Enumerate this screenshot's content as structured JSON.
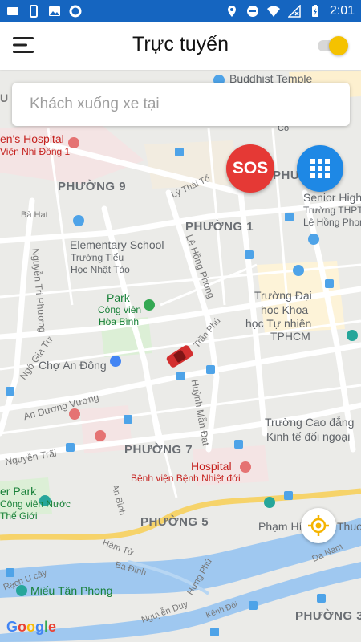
{
  "status_bar": {
    "time": "2:01"
  },
  "header": {
    "title": "Trực tuyến",
    "online_toggle": "on"
  },
  "search": {
    "placeholder": "Khách xuống xe tại"
  },
  "buttons": {
    "sos_label": "SOS"
  },
  "colors": {
    "status_bar": "#1565c0",
    "toggle_knob": "#f5c200",
    "sos": "#e53935",
    "grid_button": "#1e88e5",
    "car": "#d32f2f"
  },
  "icons": {
    "menu": "hamburger-icon",
    "grid": "apps-grid-icon",
    "locate": "my-location-icon"
  },
  "map": {
    "labels": {
      "buddhist_temple": "Buddhist Temple",
      "hospital_top": "en's Hospital",
      "vien_nhi": "Viện Nhi Đồng 1",
      "phuong9": "PHƯỜNG 9",
      "phuong1": "PHƯỜNG 1",
      "phuong7": "PHƯỜNG 7",
      "phuong5": "PHƯỜNG 5",
      "phuong3": "PHƯỜNG 3",
      "phu": "PHU",
      "senior_high": "Senior High",
      "truong_thpt": "Trường THPT",
      "le_hong_phon": "Lê Hồng Phon",
      "ly_thai_to": "Lý Thái Tổ",
      "ba_hat": "Bà Hạt",
      "elementary_school": "Elementary School",
      "truong_tieu_hoc_1": "Trường Tiểu",
      "truong_tieu_hoc_2": "Học Nhật Tảo",
      "le_hong_phong": "Lê Hồng Phong",
      "nguyen_tri_phuong": "Nguyễn Tri Phương",
      "park": "Park",
      "cong_vien": "Công viên",
      "hoa_binh": "Hòa Bình",
      "truong_dai_hoc_1": "Trường Đại",
      "truong_dai_hoc_2": "học Khoa",
      "truong_dai_hoc_3": "học Tự nhiên",
      "truong_dai_hoc_4": "TPHCM",
      "tran_phu": "Trần Phú",
      "ngo_gia_tu": "Ngô Gia Tự",
      "cho_an_dong": "Chợ An Đông",
      "an_duong_vuong": "An Dương Vương",
      "huynh_man_dat": "Huỳnh Mẫn Đạt",
      "cao_dang_1": "Trường Cao đẳng",
      "cao_dang_2": "Kinh tế đối ngoại",
      "nguyen_trai": "Nguyễn Trãi",
      "hospital": "Hospital",
      "benh_vien_nhiet_doi": "Bệnh viện Bệnh Nhiệt đới",
      "er_park": "er Park",
      "cong_vien_nuoc": "Công viên Nước",
      "the_gioi": "Thế Giới",
      "an_binh": "An Bình",
      "ham_tu": "Hàm Tử",
      "pham_hi": "Phạm Hí",
      "thuo": "Thuo",
      "ba_dinh": "Ba Đình",
      "hung_phu": "Hưng Phú",
      "rach_u_cay": "Rạch U cây",
      "mieu_tan_phong": "Miếu Tân Phong",
      "da_nam": "Dạ Nam",
      "nguyen_duy": "Nguyễn Duy",
      "kenh_doi": "Kênh Đôi",
      "google": "Google",
      "co": "Cô",
      "u": "U"
    }
  }
}
